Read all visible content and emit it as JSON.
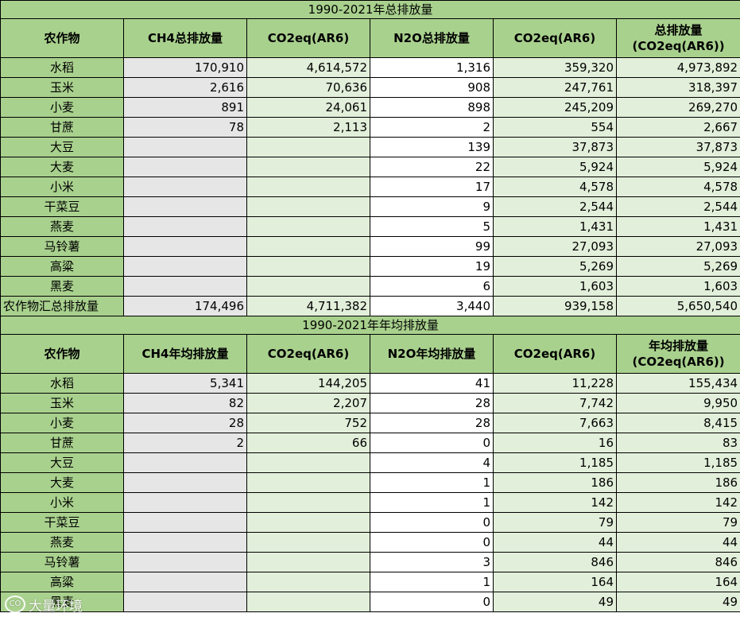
{
  "table1": {
    "title": "1990-2021年总排放量",
    "headers": [
      "农作物",
      "CH4总排放量",
      "CO2eq(AR6)",
      "N2O总排放量",
      "CO2eq(AR6)",
      "总排放量 (CO2eq(AR6))"
    ],
    "rows": [
      [
        "水稻",
        "170,910",
        "4,614,572",
        "1,316",
        "359,320",
        "4,973,892"
      ],
      [
        "玉米",
        "2,616",
        "70,636",
        "908",
        "247,761",
        "318,397"
      ],
      [
        "小麦",
        "891",
        "24,061",
        "898",
        "245,209",
        "269,270"
      ],
      [
        "甘蔗",
        "78",
        "2,113",
        "2",
        "554",
        "2,667"
      ],
      [
        "大豆",
        "",
        "",
        "139",
        "37,873",
        "37,873"
      ],
      [
        "大麦",
        "",
        "",
        "22",
        "5,924",
        "5,924"
      ],
      [
        "小米",
        "",
        "",
        "17",
        "4,578",
        "4,578"
      ],
      [
        "干菜豆",
        "",
        "",
        "9",
        "2,544",
        "2,544"
      ],
      [
        "燕麦",
        "",
        "",
        "5",
        "1,431",
        "1,431"
      ],
      [
        "马铃薯",
        "",
        "",
        "99",
        "27,093",
        "27,093"
      ],
      [
        "高粱",
        "",
        "",
        "19",
        "5,269",
        "5,269"
      ],
      [
        "黑麦",
        "",
        "",
        "6",
        "1,603",
        "1,603"
      ]
    ],
    "total": [
      "农作物汇总排放量",
      "174,496",
      "4,711,382",
      "3,440",
      "939,158",
      "5,650,540"
    ]
  },
  "table2": {
    "title": "1990-2021年年均排放量",
    "headers": [
      "农作物",
      "CH4年均排放量",
      "CO2eq(AR6)",
      "N2O年均排放量",
      "CO2eq(AR6)",
      "年均排放量 (CO2eq(AR6))"
    ],
    "rows": [
      [
        "水稻",
        "5,341",
        "144,205",
        "41",
        "11,228",
        "155,434"
      ],
      [
        "玉米",
        "82",
        "2,207",
        "28",
        "7,742",
        "9,950"
      ],
      [
        "小麦",
        "28",
        "752",
        "28",
        "7,663",
        "8,415"
      ],
      [
        "甘蔗",
        "2",
        "66",
        "0",
        "16",
        "83"
      ],
      [
        "大豆",
        "",
        "",
        "4",
        "1,185",
        "1,185"
      ],
      [
        "大麦",
        "",
        "",
        "1",
        "186",
        "186"
      ],
      [
        "小米",
        "",
        "",
        "1",
        "142",
        "142"
      ],
      [
        "干菜豆",
        "",
        "",
        "0",
        "79",
        "79"
      ],
      [
        "燕麦",
        "",
        "",
        "0",
        "44",
        "44"
      ],
      [
        "马铃薯",
        "",
        "",
        "3",
        "846",
        "846"
      ],
      [
        "高粱",
        "",
        "",
        "1",
        "164",
        "164"
      ],
      [
        "黑麦",
        "",
        "",
        "0",
        "49",
        "49"
      ]
    ]
  },
  "watermark": {
    "logo": "CO",
    "text": "大量环境"
  }
}
